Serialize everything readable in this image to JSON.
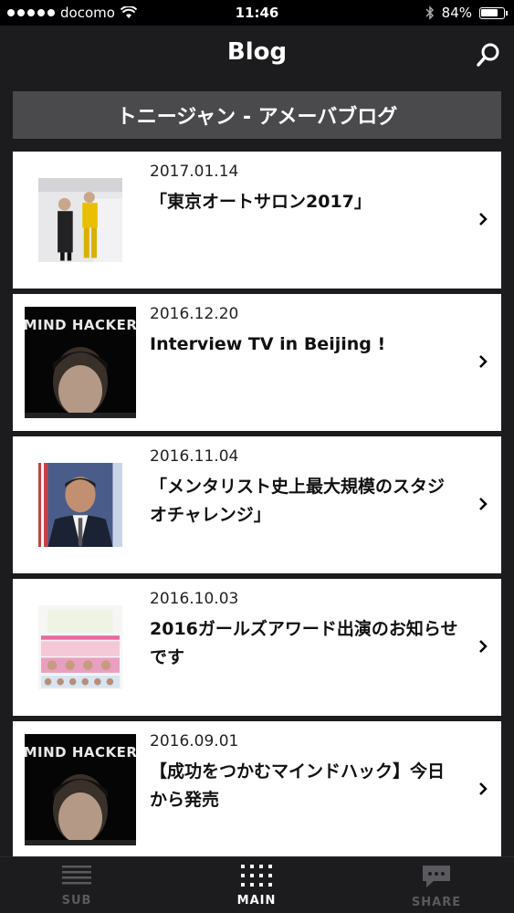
{
  "status_bar": {
    "carrier": "docomo",
    "time": "11:46",
    "battery": "84%",
    "battery_level": 0.84
  },
  "nav": {
    "title": "Blog"
  },
  "section": {
    "header": "トニージャン - アメーバブログ"
  },
  "posts": [
    {
      "date": "2017.01.14",
      "title": "「東京オートサロン2017」"
    },
    {
      "date": "2016.12.20",
      "title": "Interview TV in Beijing !"
    },
    {
      "date": "2016.11.04",
      "title": "「メンタリスト史上最大規模のスタジオチャレンジ」"
    },
    {
      "date": "2016.10.03",
      "title": "2016ガールズアワード出演のお知らせです"
    },
    {
      "date": "2016.09.01",
      "title": "【成功をつかむマインドハック】今日から発売"
    }
  ],
  "tabs": [
    {
      "label": "SUB"
    },
    {
      "label": "MAIN"
    },
    {
      "label": "SHARE"
    }
  ],
  "thumb_text": {
    "mind_hacker": "MIND HACKER"
  }
}
